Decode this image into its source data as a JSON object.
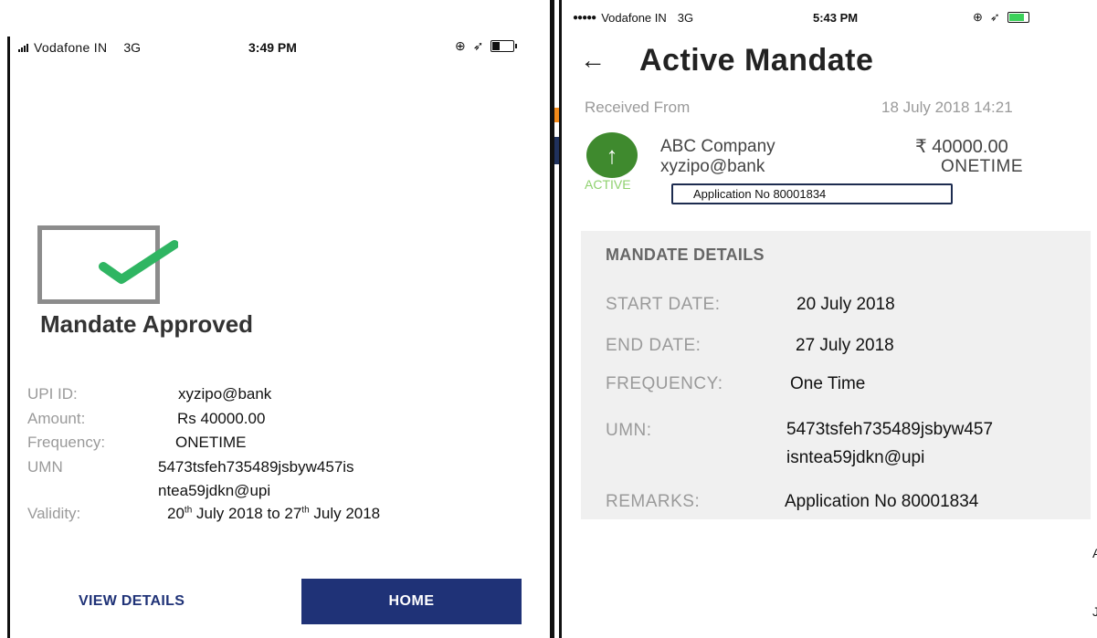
{
  "left": {
    "status": {
      "carrier": "Vodafone IN",
      "network": "3G",
      "time": "3:49 PM"
    },
    "title": "Mandate Approved",
    "details": [
      {
        "label": "UPI ID:",
        "value": "xyzipo@bank"
      },
      {
        "label": "Amount:",
        "value": "Rs 40000.00"
      },
      {
        "label": "Frequency:",
        "value": "ONETIME"
      },
      {
        "label": "UMN",
        "value_line1": "5473tsfeh735489jsbyw457is",
        "value_line2": "ntea59jdkn@upi"
      },
      {
        "label": "Validity:",
        "value_from": "20",
        "from_sup": "th",
        "value_from_rest": " July 2018 to 27",
        "to_sup": "th",
        "value_to_rest": " July 2018"
      }
    ],
    "buttons": {
      "view_details": "VIEW DETAILS",
      "home": "HOME"
    }
  },
  "right": {
    "status": {
      "dots": "●●●●●",
      "carrier": "Vodafone IN",
      "network": "3G",
      "time": "5:43 PM"
    },
    "title": "Active Mandate",
    "received_label": "Received From",
    "received_date": "18 July 2018 14:21",
    "company": "ABC Company",
    "handle": "xyzipo@bank",
    "amount": "₹ 40000.00",
    "frequency": "ONETIME",
    "status_label": "ACTIVE",
    "application_no": "Application No 80001834",
    "panel": {
      "title": "MANDATE DETAILS",
      "start_label": "START DATE:",
      "start_value": "20 July 2018",
      "end_label": "END DATE:",
      "end_value": "27 July 2018",
      "freq_label": "FREQUENCY:",
      "freq_value": "One Time",
      "umn_label": "UMN:",
      "umn_line1": "5473tsfeh735489jsbyw457",
      "umn_line2": "isntea59jdkn@upi",
      "remarks_label": "REMARKS:",
      "remarks_value": "Application No 80001834"
    }
  },
  "edge": {
    "a": "A",
    "b": "J"
  },
  "colors": {
    "primary": "#1f3277",
    "success": "#2fb562",
    "active_green": "#3f8a2e"
  }
}
